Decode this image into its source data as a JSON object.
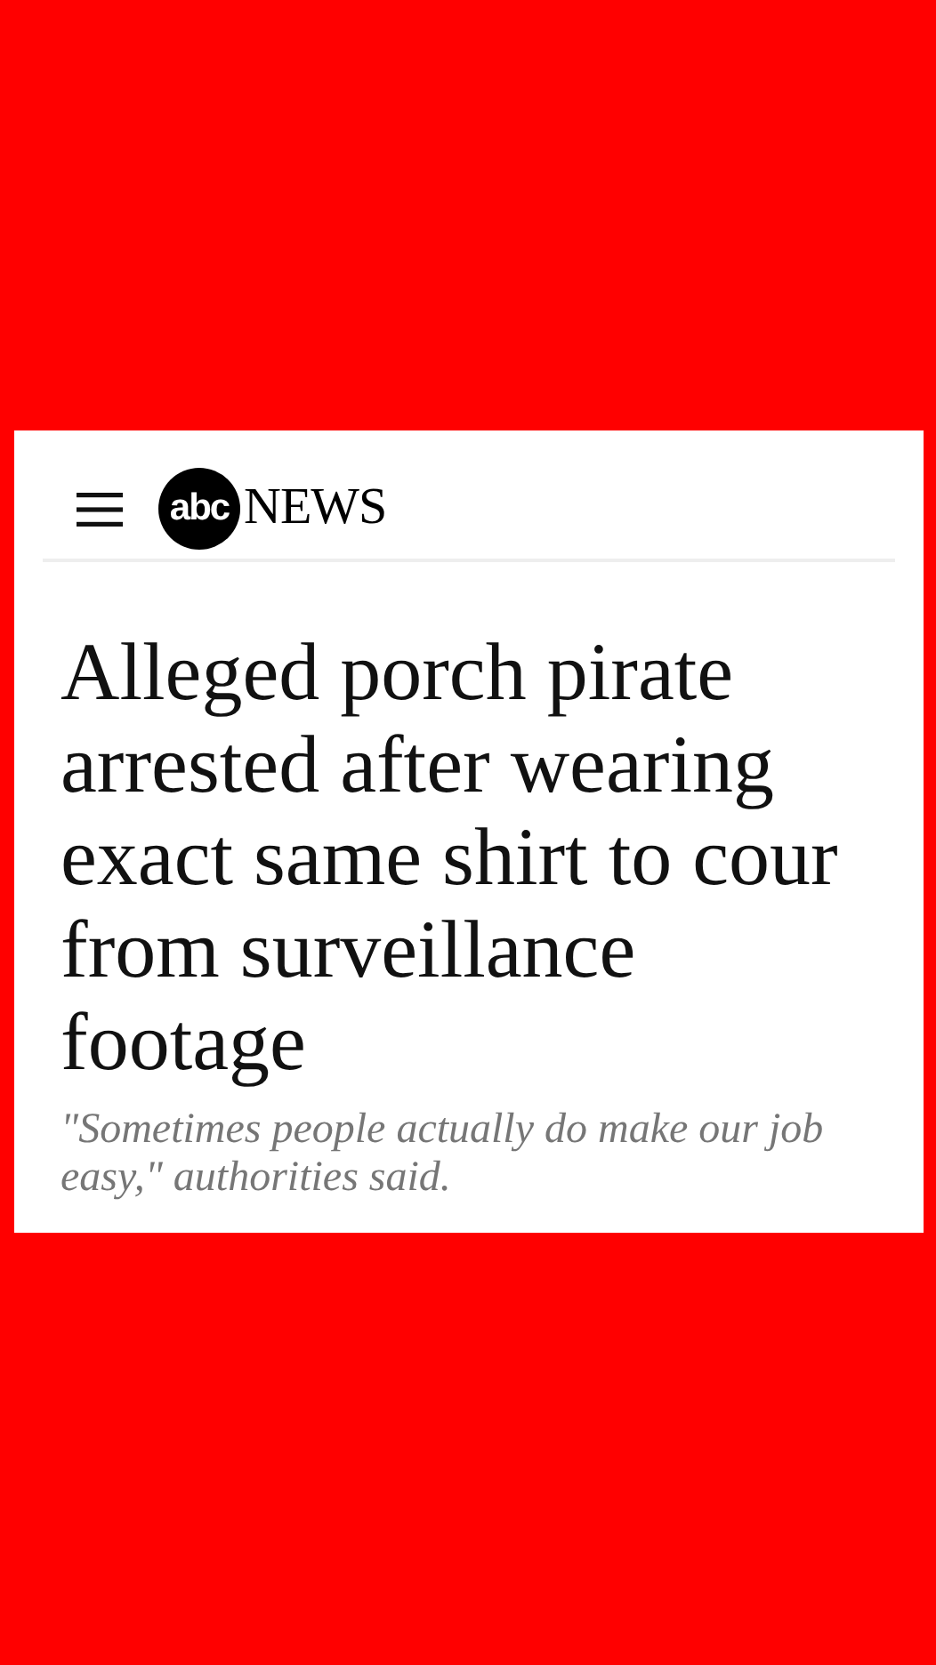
{
  "header": {
    "logo_mark": "abc",
    "logo_word": "NEWS"
  },
  "article": {
    "headline_lines": [
      "Alleged porch pirate",
      "arrested after wearing",
      "exact same shirt to cour",
      "from surveillance",
      "footage"
    ],
    "subheadline": "\"Sometimes people actually do make our job easy,\" authorities said."
  }
}
